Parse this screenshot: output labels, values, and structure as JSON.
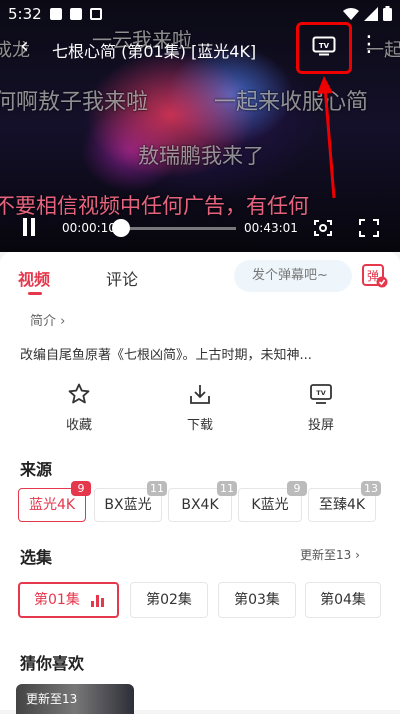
{
  "status_bar": {
    "time": "5:32"
  },
  "player": {
    "title": "七根心简 (第01集) [蓝光4K]",
    "current_time": "00:00:10",
    "duration": "00:43:01",
    "progress": 0.004,
    "danmaku": [
      "成龙",
      "一云我来啦",
      "一起",
      "何啊敖子我来啦",
      "一起来收服心简",
      "敖瑞鹏我来了",
      "不要相信视频中任何广告，有任何"
    ]
  },
  "tabs": {
    "video": "视频",
    "comments": "评论"
  },
  "danmaku_input": {
    "placeholder": "发个弹幕吧~"
  },
  "danmaku_toggle_label": "弹",
  "intro": {
    "link": "简介 ›",
    "description": "改编自尾鱼原著《七根凶简》。上古时期，未知神..."
  },
  "actions": {
    "favorite": "收藏",
    "download": "下载",
    "cast": "投屏"
  },
  "sources": {
    "title": "来源",
    "items": [
      {
        "label": "蓝光4K",
        "count": "9"
      },
      {
        "label": "BX蓝光",
        "count": "11"
      },
      {
        "label": "BX4K",
        "count": "11"
      },
      {
        "label": "K蓝光",
        "count": "9"
      },
      {
        "label": "至臻4K",
        "count": "13"
      }
    ]
  },
  "episodes": {
    "title": "选集",
    "update_link": "更新至13 ›",
    "items": [
      "第01集",
      "第02集",
      "第03集",
      "第04集"
    ]
  },
  "recommend": {
    "title": "猜你喜欢",
    "first_badge": "更新至13"
  },
  "colors": {
    "accent": "#e5384d",
    "highlight_box": "#e00000"
  }
}
